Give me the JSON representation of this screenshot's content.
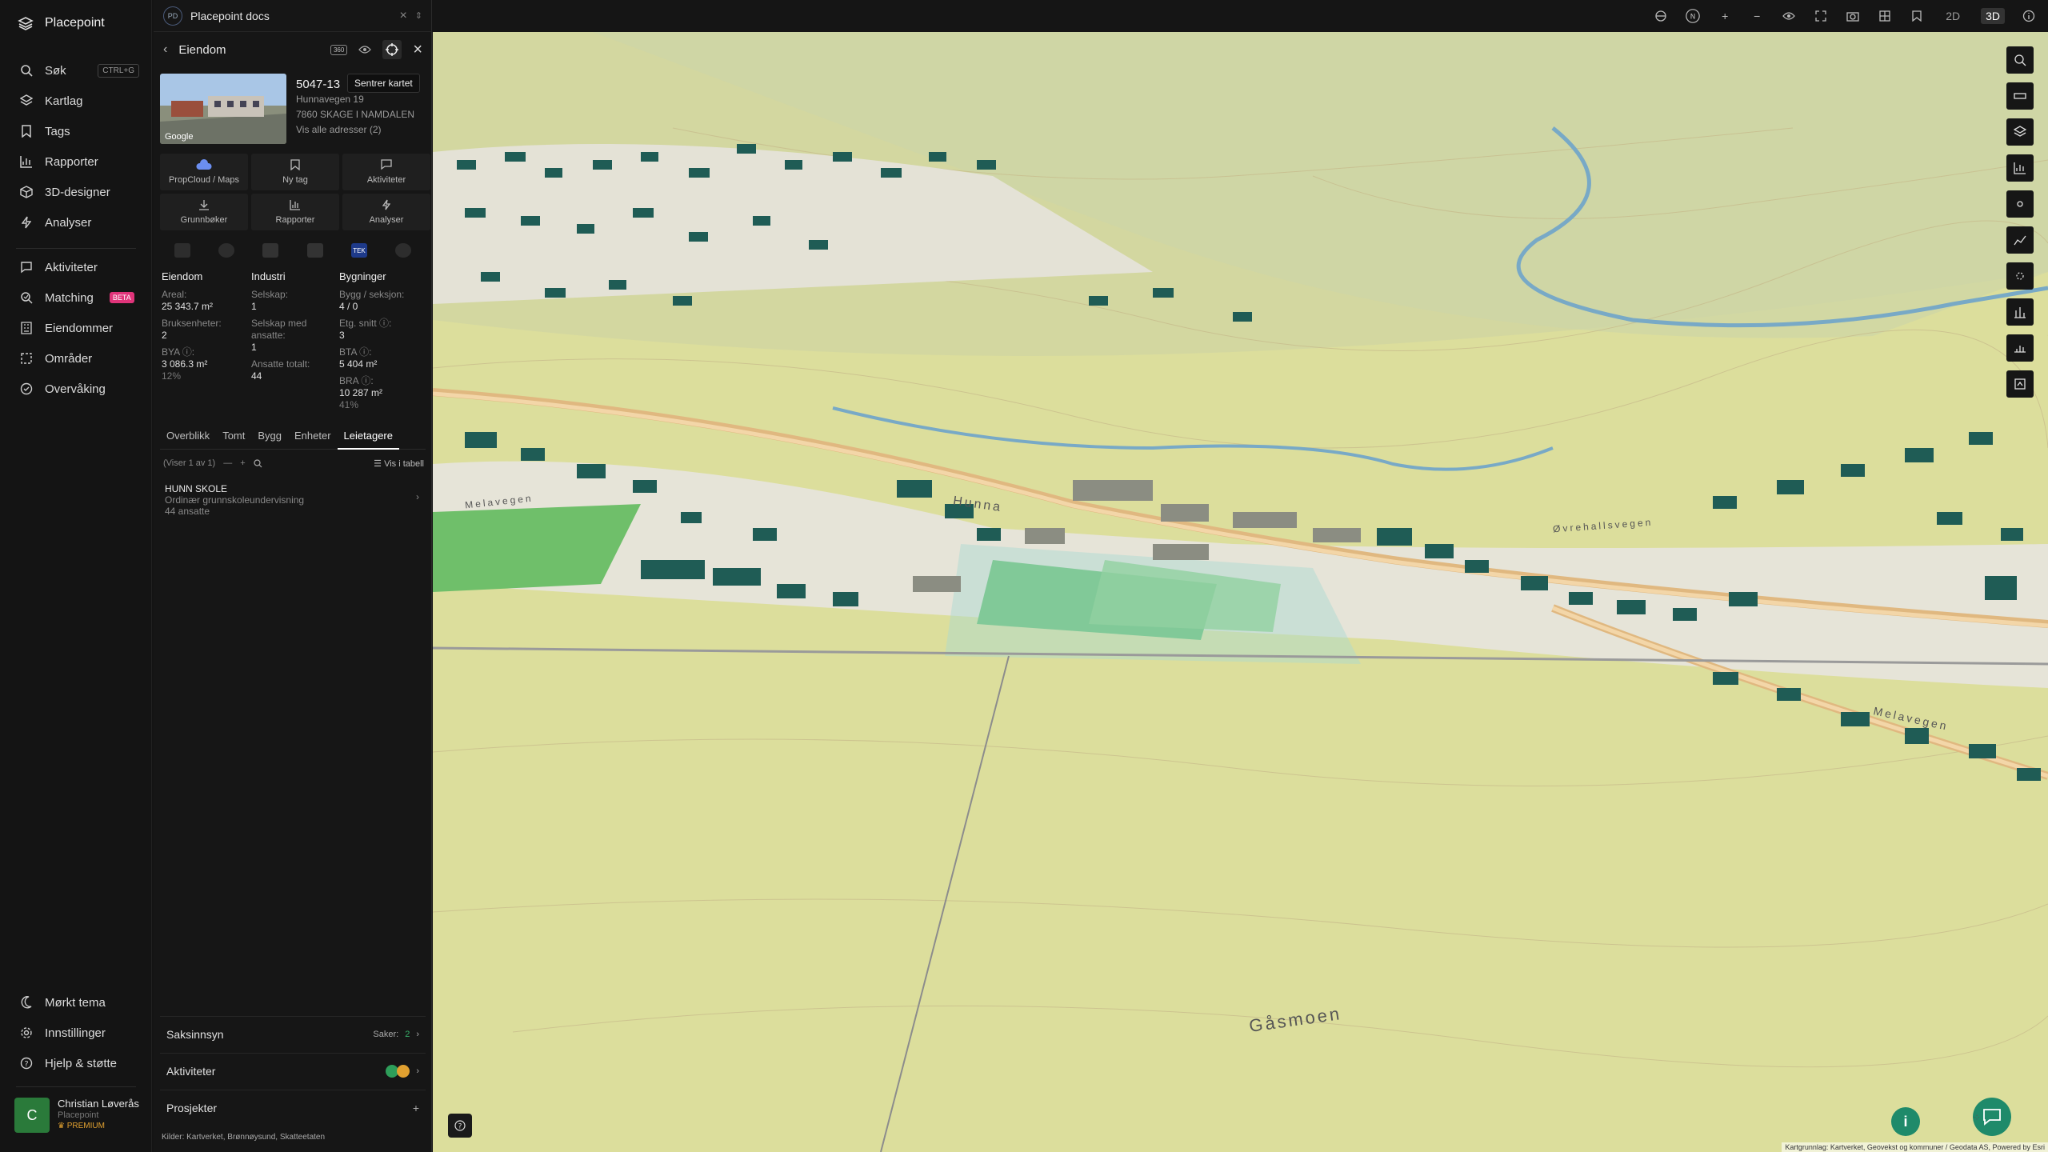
{
  "app": {
    "name": "Placepoint"
  },
  "nav": {
    "items": [
      {
        "label": "Søk",
        "shortcut": "CTRL+G",
        "icon": "search-icon"
      },
      {
        "label": "Kartlag",
        "icon": "layers-icon"
      },
      {
        "label": "Tags",
        "icon": "bookmark-icon"
      },
      {
        "label": "Rapporter",
        "icon": "bar-chart-icon"
      },
      {
        "label": "3D-designer",
        "icon": "cube-icon"
      },
      {
        "label": "Analyser",
        "icon": "bolt-icon"
      }
    ],
    "items2": [
      {
        "label": "Aktiviteter",
        "icon": "chat-icon"
      },
      {
        "label": "Matching",
        "badge": "BETA",
        "icon": "match-icon"
      },
      {
        "label": "Eiendommer",
        "icon": "building-icon"
      },
      {
        "label": "Områder",
        "icon": "area-icon"
      },
      {
        "label": "Overvåking",
        "icon": "check-circle-icon"
      }
    ],
    "footer": [
      {
        "label": "Mørkt tema",
        "icon": "moon-icon"
      },
      {
        "label": "Innstillinger",
        "icon": "gear-icon"
      },
      {
        "label": "Hjelp & støtte",
        "icon": "help-icon"
      }
    ],
    "user": {
      "initial": "C",
      "name": "Christian Løverås",
      "org": "Placepoint",
      "plan": "PREMIUM"
    }
  },
  "doc": {
    "chip": "PD",
    "title": "Placepoint docs"
  },
  "panel": {
    "title": "Eiendom",
    "tooltip": "Sentrer kartet",
    "thumb_label": "Google",
    "property": {
      "id": "5047-13",
      "address": "Hunnavegen 19",
      "city": "7860 SKAGE I NAMDALEN",
      "all_addresses": "Vis alle adresser (2)"
    },
    "tiles": [
      {
        "label": "PropCloud / Maps",
        "icon": "cloud-icon"
      },
      {
        "label": "Ny tag",
        "icon": "tag-icon"
      },
      {
        "label": "Aktiviteter",
        "icon": "chat-icon"
      },
      {
        "label": "Grunnbøker",
        "icon": "download-icon"
      },
      {
        "label": "Rapporter",
        "icon": "bar-chart-icon"
      },
      {
        "label": "Analyser",
        "icon": "bolt-icon"
      }
    ],
    "layer_badge": "TEK",
    "eiendom": {
      "heading": "Eiendom",
      "areal_label": "Areal:",
      "areal_value": "25 343.7 m²",
      "bruks_label": "Bruksenheter:",
      "bruks_value": "2",
      "bya_label": "BYA ⓘ:",
      "bya_value": "3 086.3 m²",
      "bya_pct": "12%"
    },
    "industri": {
      "heading": "Industri",
      "selskap_label": "Selskap:",
      "selskap_value": "1",
      "ansatte_label": "Selskap med ansatte:",
      "ansatte_value": "1",
      "totalt_label": "Ansatte totalt:",
      "totalt_value": "44"
    },
    "bygninger": {
      "heading": "Bygninger",
      "bygg_label": "Bygg / seksjon:",
      "bygg_value": "4 / 0",
      "etg_label": "Etg. snitt ⓘ:",
      "etg_value": "3",
      "bta_label": "BTA ⓘ:",
      "bta_value": "5 404 m²",
      "bra_label": "BRA ⓘ:",
      "bra_value": "10 287 m²",
      "bra_pct": "41%"
    },
    "tabs": [
      "Overblikk",
      "Tomt",
      "Bygg",
      "Enheter",
      "Leietagere"
    ],
    "active_tab": "Leietagere",
    "showing": "(Viser 1 av 1)",
    "table_toggle": "Vis i tabell",
    "tenant": {
      "name": "HUNN SKOLE",
      "desc": "Ordinær grunnskoleundervisning",
      "employees": "44 ansatte"
    },
    "saksinnsyn": {
      "label": "Saksinnsyn",
      "count_label": "Saker:",
      "count": "2"
    },
    "aktiviteter": {
      "label": "Aktiviteter"
    },
    "prosjekter": {
      "label": "Prosjekter"
    },
    "sources": {
      "label": "Kilder:",
      "items": [
        "Kartverket,",
        "Brønnøysund,",
        "Skatteetaten"
      ]
    }
  },
  "topbar": {
    "mode_2d": "2D",
    "mode_3d": "3D",
    "compass": "N"
  },
  "map": {
    "labels": {
      "place": "Gåsmoen",
      "road1": "Melavegen",
      "road2": "Øvrehallsvegen",
      "road3": "Hunna",
      "road4": "Melavegen"
    },
    "attribution": "Kartgrunnlag: Kartverket, Geovekst og kommuner / Geodata AS, Powered by Esri"
  },
  "colors": {
    "accent": "#1f7a6a",
    "building": "#1e5e55",
    "field": "#d9dc9a",
    "green": "#5cbb62"
  }
}
